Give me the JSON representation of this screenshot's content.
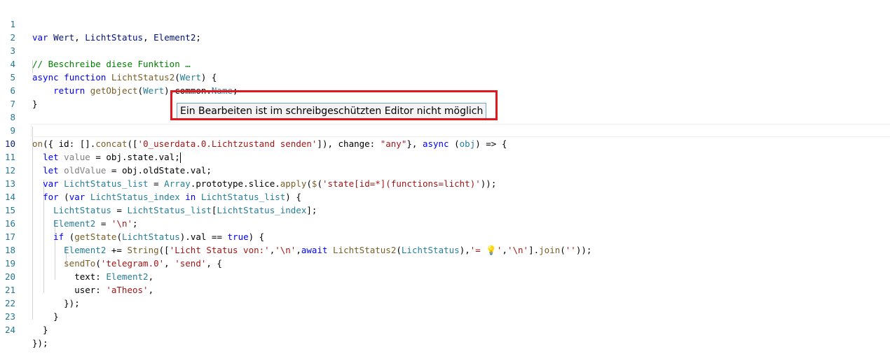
{
  "editor": {
    "active_line": 10,
    "readonly_message": "Ein Bearbeiten ist im schreibgeschützten Editor nicht möglich",
    "lines": [
      {
        "num": "1",
        "text": "var Wert, LichtStatus, Element2;"
      },
      {
        "num": "2",
        "text": ""
      },
      {
        "num": "3",
        "text": "// Beschreibe diese Funktion …"
      },
      {
        "num": "4",
        "text": "async function LichtStatus2(Wert) {"
      },
      {
        "num": "5",
        "text": "    return getObject(Wert).common.Name;"
      },
      {
        "num": "6",
        "text": "}"
      },
      {
        "num": "7",
        "text": ""
      },
      {
        "num": "8",
        "text": ""
      },
      {
        "num": "9",
        "text": "on({ id: [].concat(['0_userdata.0.Lichtzustand senden']), change: \"any\"}, async (obj) => {"
      },
      {
        "num": "10",
        "text": "  let value = obj.state.val;"
      },
      {
        "num": "11",
        "text": "  let oldValue = obj.oldState.val;"
      },
      {
        "num": "12",
        "text": "  var LichtStatus_list = Array.prototype.slice.apply($('state[id=*](functions=licht)'));"
      },
      {
        "num": "13",
        "text": "  for (var LichtStatus_index in LichtStatus_list) {"
      },
      {
        "num": "14",
        "text": "    LichtStatus = LichtStatus_list[LichtStatus_index];"
      },
      {
        "num": "15",
        "text": "    Element2 = '\\n';"
      },
      {
        "num": "16",
        "text": "    if (getState(LichtStatus).val == true) {"
      },
      {
        "num": "17",
        "text": "      Element2 += String(['Licht Status von:','\\n',await LichtStatus2(LichtStatus),'= 💡','\\n'].join(''));"
      },
      {
        "num": "18",
        "text": "      sendTo('telegram.0', 'send', {"
      },
      {
        "num": "19",
        "text": "        text: Element2,"
      },
      {
        "num": "20",
        "text": "        user: 'aTheos',"
      },
      {
        "num": "21",
        "text": "      });"
      },
      {
        "num": "22",
        "text": "    }"
      },
      {
        "num": "23",
        "text": "  }"
      },
      {
        "num": "24",
        "text": "});"
      }
    ]
  }
}
